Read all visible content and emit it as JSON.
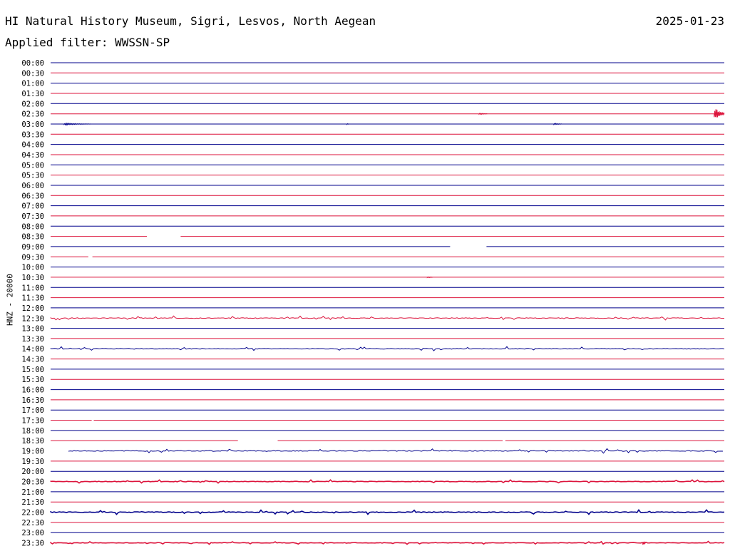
{
  "header": {
    "title": "HI Natural History Museum, Sigri, Lesvos, North Aegean",
    "date": "2025-01-23",
    "filter": "Applied filter: WWSSN-SP"
  },
  "colors": {
    "even": "#00008b",
    "odd": "#dc143c"
  },
  "chart_data": {
    "type": "line",
    "ylabel": "HNZ - 20000",
    "grid": false,
    "rows": [
      {
        "label": "00:00",
        "gaps": [],
        "events": []
      },
      {
        "label": "00:30",
        "gaps": [],
        "events": []
      },
      {
        "label": "01:00",
        "gaps": [],
        "events": []
      },
      {
        "label": "01:30",
        "gaps": [],
        "events": []
      },
      {
        "label": "02:00",
        "gaps": [],
        "events": []
      },
      {
        "label": "02:30",
        "gaps": [],
        "events": [
          {
            "x": 0.636,
            "amp": 1.5,
            "w": 0.012
          },
          {
            "x": 0.985,
            "amp": 11,
            "w": 0.02
          }
        ]
      },
      {
        "label": "03:00",
        "gaps": [],
        "events": [
          {
            "x": 0.02,
            "amp": 1.5,
            "w": 0.04
          },
          {
            "x": 0.44,
            "amp": 1.5,
            "w": 0.003
          },
          {
            "x": 0.747,
            "amp": 1.5,
            "w": 0.012
          }
        ]
      },
      {
        "label": "03:30",
        "gaps": [],
        "events": []
      },
      {
        "label": "04:00",
        "gaps": [],
        "events": []
      },
      {
        "label": "04:30",
        "gaps": [],
        "events": []
      },
      {
        "label": "05:00",
        "gaps": [],
        "events": []
      },
      {
        "label": "05:30",
        "gaps": [],
        "events": []
      },
      {
        "label": "06:00",
        "gaps": [],
        "events": []
      },
      {
        "label": "06:30",
        "gaps": [],
        "events": []
      },
      {
        "label": "07:00",
        "gaps": [],
        "events": []
      },
      {
        "label": "07:30",
        "gaps": [],
        "events": []
      },
      {
        "label": "08:00",
        "gaps": [],
        "events": []
      },
      {
        "label": "08:30",
        "gaps": [
          [
            0.143,
            0.193
          ]
        ],
        "events": []
      },
      {
        "label": "09:00",
        "gaps": [
          [
            0.593,
            0.647
          ]
        ],
        "events": []
      },
      {
        "label": "09:30",
        "gaps": [
          [
            0.056,
            0.062
          ]
        ],
        "events": []
      },
      {
        "label": "10:00",
        "gaps": [],
        "events": []
      },
      {
        "label": "10:30",
        "gaps": [],
        "events": [
          {
            "x": 0.559,
            "amp": 1.5,
            "w": 0.008
          }
        ]
      },
      {
        "label": "11:00",
        "gaps": [],
        "events": []
      },
      {
        "label": "11:30",
        "gaps": [],
        "events": []
      },
      {
        "label": "12:00",
        "gaps": [],
        "events": []
      },
      {
        "label": "12:30",
        "gaps": [],
        "events": [],
        "noise": 1.2
      },
      {
        "label": "13:00",
        "gaps": [],
        "events": []
      },
      {
        "label": "13:30",
        "gaps": [],
        "events": []
      },
      {
        "label": "14:00",
        "gaps": [],
        "events": [],
        "noise": 1.2
      },
      {
        "label": "14:30",
        "gaps": [],
        "events": []
      },
      {
        "label": "15:00",
        "gaps": [],
        "events": []
      },
      {
        "label": "15:30",
        "gaps": [],
        "events": []
      },
      {
        "label": "16:00",
        "gaps": [],
        "events": []
      },
      {
        "label": "16:30",
        "gaps": [],
        "events": []
      },
      {
        "label": "17:00",
        "gaps": [],
        "events": []
      },
      {
        "label": "17:30",
        "gaps": [
          [
            0.061,
            0.064
          ]
        ],
        "events": []
      },
      {
        "label": "18:00",
        "gaps": [],
        "events": []
      },
      {
        "label": "18:30",
        "gaps": [
          [
            0.278,
            0.337
          ],
          [
            0.671,
            0.675
          ]
        ],
        "events": []
      },
      {
        "label": "19:00",
        "gaps": [
          [
            0.0,
            0.027
          ]
        ],
        "events": [],
        "noise": 1.3
      },
      {
        "label": "19:30",
        "gaps": [],
        "events": []
      },
      {
        "label": "20:00",
        "gaps": [],
        "events": []
      },
      {
        "label": "20:30",
        "gaps": [],
        "events": [],
        "noise": 1.0,
        "thick": true
      },
      {
        "label": "21:00",
        "gaps": [],
        "events": []
      },
      {
        "label": "21:30",
        "gaps": [],
        "events": []
      },
      {
        "label": "22:00",
        "gaps": [],
        "events": [],
        "noise": 1.3,
        "thick": true
      },
      {
        "label": "22:30",
        "gaps": [],
        "events": []
      },
      {
        "label": "23:00",
        "gaps": [],
        "events": []
      },
      {
        "label": "23:30",
        "gaps": [],
        "events": [
          {
            "x": 0.879,
            "amp": 6,
            "w": 0.004
          }
        ],
        "noise": 0.8,
        "thick": true
      }
    ]
  }
}
